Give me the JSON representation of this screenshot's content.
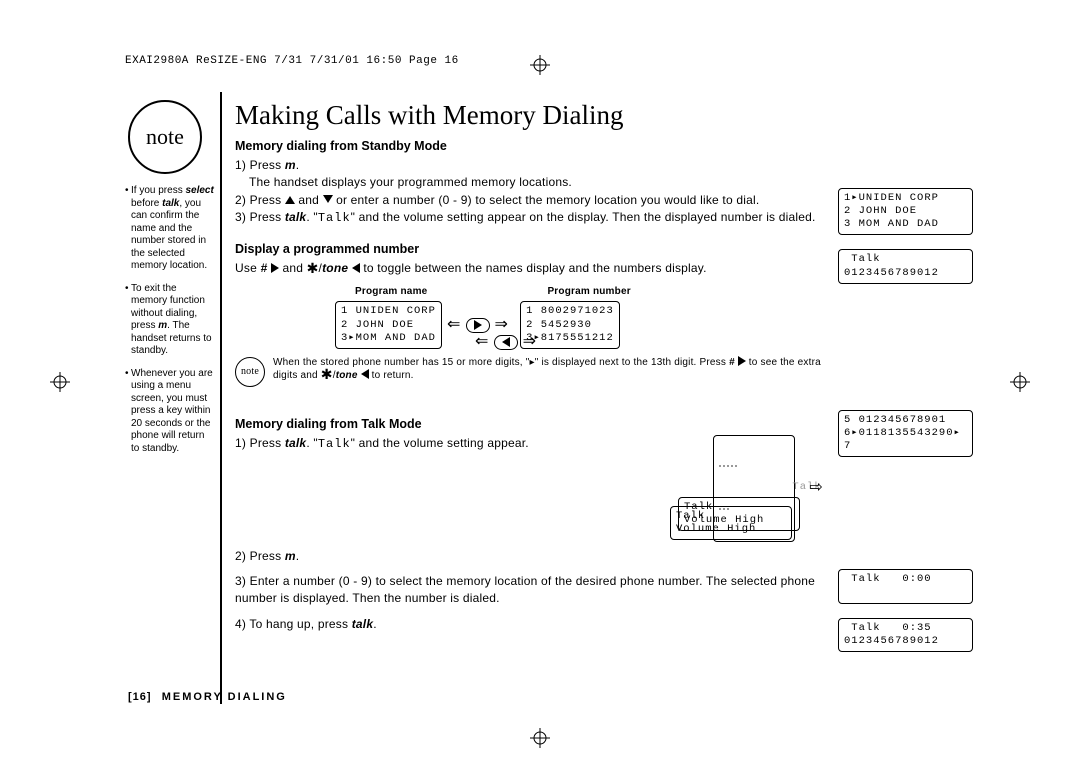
{
  "header_line": "EXAI2980A ReSIZE-ENG 7/31  7/31/01  16:50  Page 16",
  "note_badge": "note",
  "sidebar": {
    "items": [
      "If you press <b><i>select</i></b> before <b><i>talk</i></b>, you can confirm the name and the number stored in the selected memory location.",
      "To exit the memory function without dialing, press <b><i>m</i></b>. The handset returns to standby.",
      "Whenever you are using a menu screen, you must press a key within 20 seconds or the phone will return to standby."
    ]
  },
  "title": "Making Calls with Memory Dialing",
  "section1": {
    "heading": "Memory dialing from Standby Mode",
    "step1a": "Press ",
    "step1b": "The handset displays your programmed memory locations.",
    "step2": "Press __UP__ and __DOWN__ or enter a number (0 - 9) to select the memory location you would like to dial.",
    "step3": "Press <b><i>talk</i></b>. \"<span class='mono'>Talk</span>\" and the volume setting appear on the display. Then the displayed number is dialed."
  },
  "section2": {
    "heading": "Display a programmed number",
    "text": "Use <b><i>#</i></b> __TR__ and <span class='star'>✱</span>/<b><i>tone</i></b> __TL__ to toggle between the names display and the numbers display.",
    "label_name": "Program name",
    "label_number": "Program number",
    "lcd_names": "1 UNIDEN CORP\n2 JOHN DOE\n3▸MOM AND DAD",
    "lcd_numbers": "1 8002971023\n2 5452930\n3▸8175551212",
    "note_text": "When the stored phone number has 15 or more digits, \"▸\" is displayed next to the 13th digit. Press <b><i>#</i></b> __TR__ to see the extra digits and <span class='star'>✱</span>/<b><i>tone</i></b> __TL__ to return."
  },
  "section3": {
    "heading": "Memory dialing from Talk Mode",
    "step1": "Press <b><i>talk</i></b>. \"<span class='mono'>Talk</span>\" and the volume setting appear.",
    "step2": "Press <b><i>m</i></b>.",
    "step3": "Enter a number (0 - 9) to select the memory location of the desired phone number. The selected phone number is displayed. Then the number is dialed.",
    "step4": "To hang up, press <b><i>talk</i></b>.",
    "lcd_talk_fade": "Talk",
    "lcd_talk_vol": "Talk\nVolume High"
  },
  "right_lcds": {
    "a": "1▸UNIDEN CORP\n2 JOHN DOE\n3 MOM AND DAD",
    "b": " Talk\n0123456789012",
    "c": "5 012345678901\n6▸0118135543290▸\n7",
    "d": " Talk   0:00\n ",
    "e": " Talk   0:35\n0123456789012"
  },
  "footer": {
    "pg": "[16]",
    "txt": "MEMORY DIALING"
  }
}
